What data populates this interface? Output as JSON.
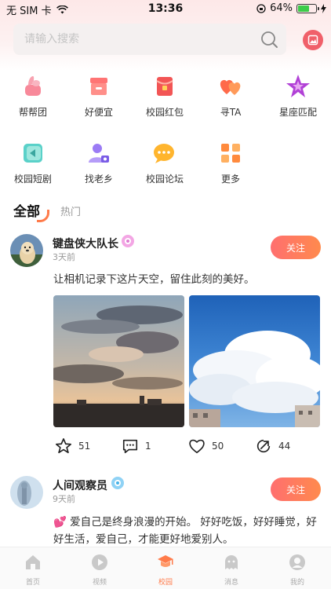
{
  "status_bar": {
    "carrier": "无 SIM 卡",
    "time": "13:36",
    "battery": "64%"
  },
  "search": {
    "placeholder": "请输入搜索"
  },
  "grid": [
    {
      "label": "帮帮团",
      "icon": "hand-icon"
    },
    {
      "label": "好便宜",
      "icon": "shop-icon"
    },
    {
      "label": "校园红包",
      "icon": "red-packet-icon"
    },
    {
      "label": "寻TA",
      "icon": "hearts-icon"
    },
    {
      "label": "星座匹配",
      "icon": "star-icon"
    },
    {
      "label": "校园短剧",
      "icon": "play-icon"
    },
    {
      "label": "找老乡",
      "icon": "person-icon"
    },
    {
      "label": "校园论坛",
      "icon": "chat-icon"
    },
    {
      "label": "更多",
      "icon": "more-icon"
    }
  ],
  "tabs": {
    "all": "全部",
    "hot": "热门"
  },
  "posts": [
    {
      "name": "键盘侠大队长",
      "time": "3天前",
      "follow": "关注",
      "text": "让相机记录下这片天空，留住此刻的美好。",
      "stats": {
        "stars": "51",
        "comments": "1",
        "likes": "50",
        "shares": "44"
      }
    },
    {
      "name": "人间观察员",
      "time": "9天前",
      "follow": "关注",
      "text": "💕 爱自己是终身浪漫的开始。 好好吃饭，好好睡觉，好好生活，爱自己，才能更好地爱别人。"
    }
  ],
  "nav": {
    "home": "首页",
    "video": "视频",
    "campus": "校园",
    "message": "消息",
    "mine": "我的"
  },
  "colors": {
    "accent": "#ff7b4a",
    "follow": "#ff6f6f"
  }
}
